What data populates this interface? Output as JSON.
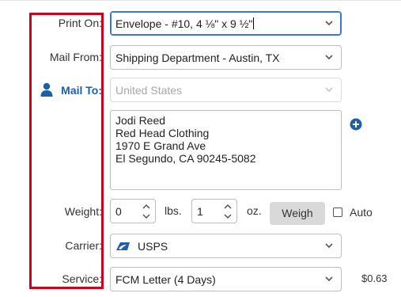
{
  "form": {
    "print_on": {
      "label": "Print On:",
      "value": "Envelope - #10, 4 ⅛\" x 9 ½\""
    },
    "mail_from": {
      "label": "Mail From:",
      "value": "Shipping Department - Austin, TX"
    },
    "mail_to": {
      "label": "Mail To:",
      "country_placeholder": "United States",
      "address_lines": [
        "Jodi Reed",
        "Red Head Clothing",
        "1970 E Grand Ave",
        "El Segundo, CA 90245-5082"
      ]
    },
    "weight": {
      "label": "Weight:",
      "lbs_value": "0",
      "lbs_unit": "lbs.",
      "oz_value": "1",
      "oz_unit": "oz.",
      "weigh_button": "Weigh",
      "auto_label": "Auto"
    },
    "carrier": {
      "label": "Carrier:",
      "value": "USPS",
      "icon": "usps-eagle-icon"
    },
    "service": {
      "label": "Service:",
      "value": "FCM Letter (4 Days)",
      "price": "$0.63"
    }
  },
  "colors": {
    "highlight_border": "#d0021b",
    "accent_blue": "#1f5fa8",
    "weigh_button_bg": "#d9d9d9"
  }
}
